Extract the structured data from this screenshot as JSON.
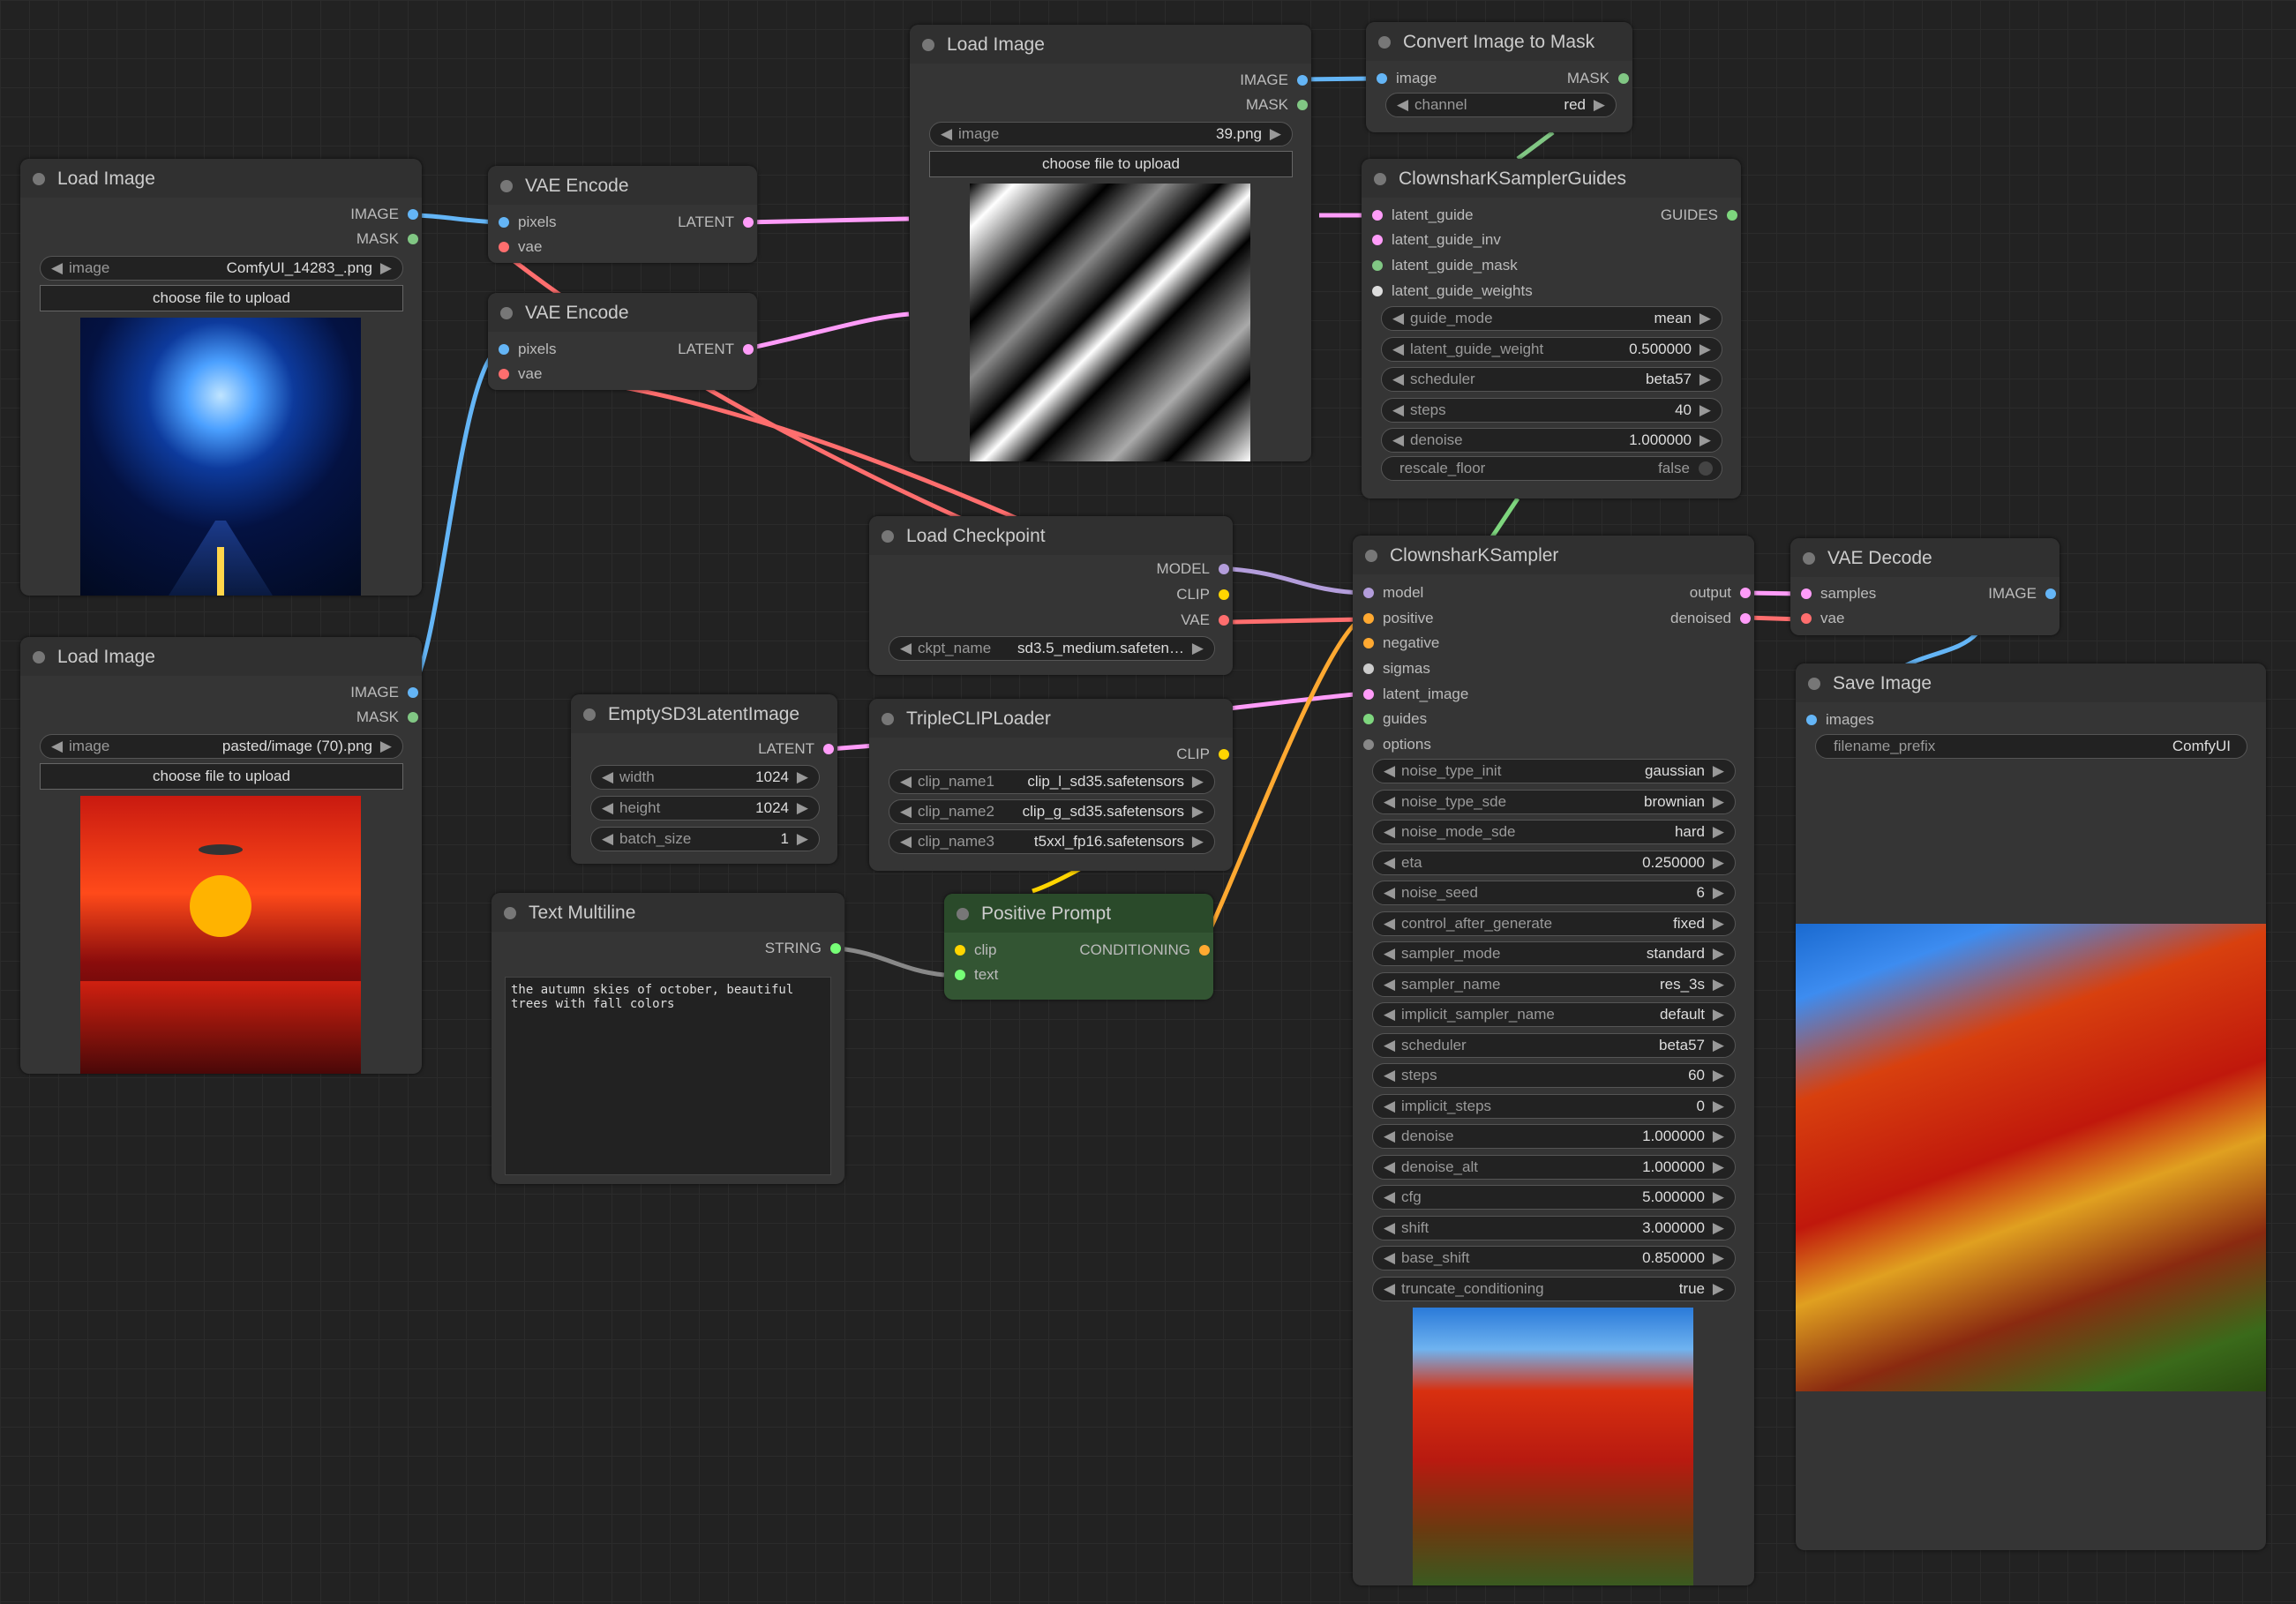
{
  "colors": {
    "image": "#64b5f6",
    "mask": "#81c784",
    "latent": "#ff9cf9",
    "vae": "#ff6e6e",
    "model": "#b39ddb",
    "clip": "#ffd500",
    "conditioning": "#ffa931",
    "guides": "#7ed67e",
    "string": "#77ff77",
    "output": "#ff9cf9"
  },
  "load_image_1": {
    "title": "Load Image",
    "out_image": "IMAGE",
    "out_mask": "MASK",
    "widget_label": "image",
    "widget_value": "ComfyUI_14283_.png",
    "upload": "choose file to upload"
  },
  "load_image_2": {
    "title": "Load Image",
    "out_image": "IMAGE",
    "out_mask": "MASK",
    "widget_label": "image",
    "widget_value": "pasted/image (70).png",
    "upload": "choose file to upload"
  },
  "load_image_3": {
    "title": "Load Image",
    "out_image": "IMAGE",
    "out_mask": "MASK",
    "widget_label": "image",
    "widget_value": "39.png",
    "upload": "choose file to upload"
  },
  "vae_encode_1": {
    "title": "VAE Encode",
    "in_pixels": "pixels",
    "in_vae": "vae",
    "out_latent": "LATENT"
  },
  "vae_encode_2": {
    "title": "VAE Encode",
    "in_pixels": "pixels",
    "in_vae": "vae",
    "out_latent": "LATENT"
  },
  "convert_mask": {
    "title": "Convert Image to Mask",
    "in_image": "image",
    "out_mask": "MASK",
    "channel_label": "channel",
    "channel_value": "red"
  },
  "guides": {
    "title": "ClownsharKSamplerGuides",
    "inputs": [
      "latent_guide",
      "latent_guide_inv",
      "latent_guide_mask",
      "latent_guide_weights"
    ],
    "output": "GUIDES",
    "widgets": [
      {
        "label": "guide_mode",
        "value": "mean"
      },
      {
        "label": "latent_guide_weight",
        "value": "0.500000"
      },
      {
        "label": "scheduler",
        "value": "beta57"
      },
      {
        "label": "steps",
        "value": "40"
      },
      {
        "label": "denoise",
        "value": "1.000000"
      }
    ],
    "toggle": {
      "label": "rescale_floor",
      "value": "false"
    }
  },
  "load_checkpoint": {
    "title": "Load Checkpoint",
    "out_model": "MODEL",
    "out_clip": "CLIP",
    "out_vae": "VAE",
    "ckpt_label": "ckpt_name",
    "ckpt_value": "sd3.5_medium.safeten…"
  },
  "empty_latent": {
    "title": "EmptySD3LatentImage",
    "out_latent": "LATENT",
    "widgets": [
      {
        "label": "width",
        "value": "1024"
      },
      {
        "label": "height",
        "value": "1024"
      },
      {
        "label": "batch_size",
        "value": "1"
      }
    ]
  },
  "triple_clip": {
    "title": "TripleCLIPLoader",
    "out_clip": "CLIP",
    "widgets": [
      {
        "label": "clip_name1",
        "value": "clip_l_sd35.safetensors"
      },
      {
        "label": "clip_name2",
        "value": "clip_g_sd35.safetensors"
      },
      {
        "label": "clip_name3",
        "value": "t5xxl_fp16.safetensors"
      }
    ]
  },
  "text_multiline": {
    "title": "Text Multiline",
    "out_string": "STRING",
    "text": "the autumn skies of october, beautiful\ntrees with fall colors"
  },
  "positive_prompt": {
    "title": "Positive Prompt",
    "in_clip": "clip",
    "in_text": "text",
    "out_cond": "CONDITIONING"
  },
  "sampler": {
    "title": "ClownsharKSampler",
    "inputs": [
      "model",
      "positive",
      "negative",
      "sigmas",
      "latent_image",
      "guides",
      "options"
    ],
    "out_output": "output",
    "out_denoised": "denoised",
    "widgets": [
      {
        "label": "noise_type_init",
        "value": "gaussian"
      },
      {
        "label": "noise_type_sde",
        "value": "brownian"
      },
      {
        "label": "noise_mode_sde",
        "value": "hard"
      },
      {
        "label": "eta",
        "value": "0.250000"
      },
      {
        "label": "noise_seed",
        "value": "6"
      },
      {
        "label": "control_after_generate",
        "value": "fixed"
      },
      {
        "label": "sampler_mode",
        "value": "standard"
      },
      {
        "label": "sampler_name",
        "value": "res_3s"
      },
      {
        "label": "implicit_sampler_name",
        "value": "default"
      },
      {
        "label": "scheduler",
        "value": "beta57"
      },
      {
        "label": "steps",
        "value": "60"
      },
      {
        "label": "implicit_steps",
        "value": "0"
      },
      {
        "label": "denoise",
        "value": "1.000000"
      },
      {
        "label": "denoise_alt",
        "value": "1.000000"
      },
      {
        "label": "cfg",
        "value": "5.000000"
      },
      {
        "label": "shift",
        "value": "3.000000"
      },
      {
        "label": "base_shift",
        "value": "0.850000"
      },
      {
        "label": "truncate_conditioning",
        "value": "true"
      }
    ]
  },
  "vae_decode": {
    "title": "VAE Decode",
    "in_samples": "samples",
    "in_vae": "vae",
    "out_image": "IMAGE"
  },
  "save_image": {
    "title": "Save Image",
    "in_images": "images",
    "prefix_label": "filename_prefix",
    "prefix_value": "ComfyUI"
  }
}
